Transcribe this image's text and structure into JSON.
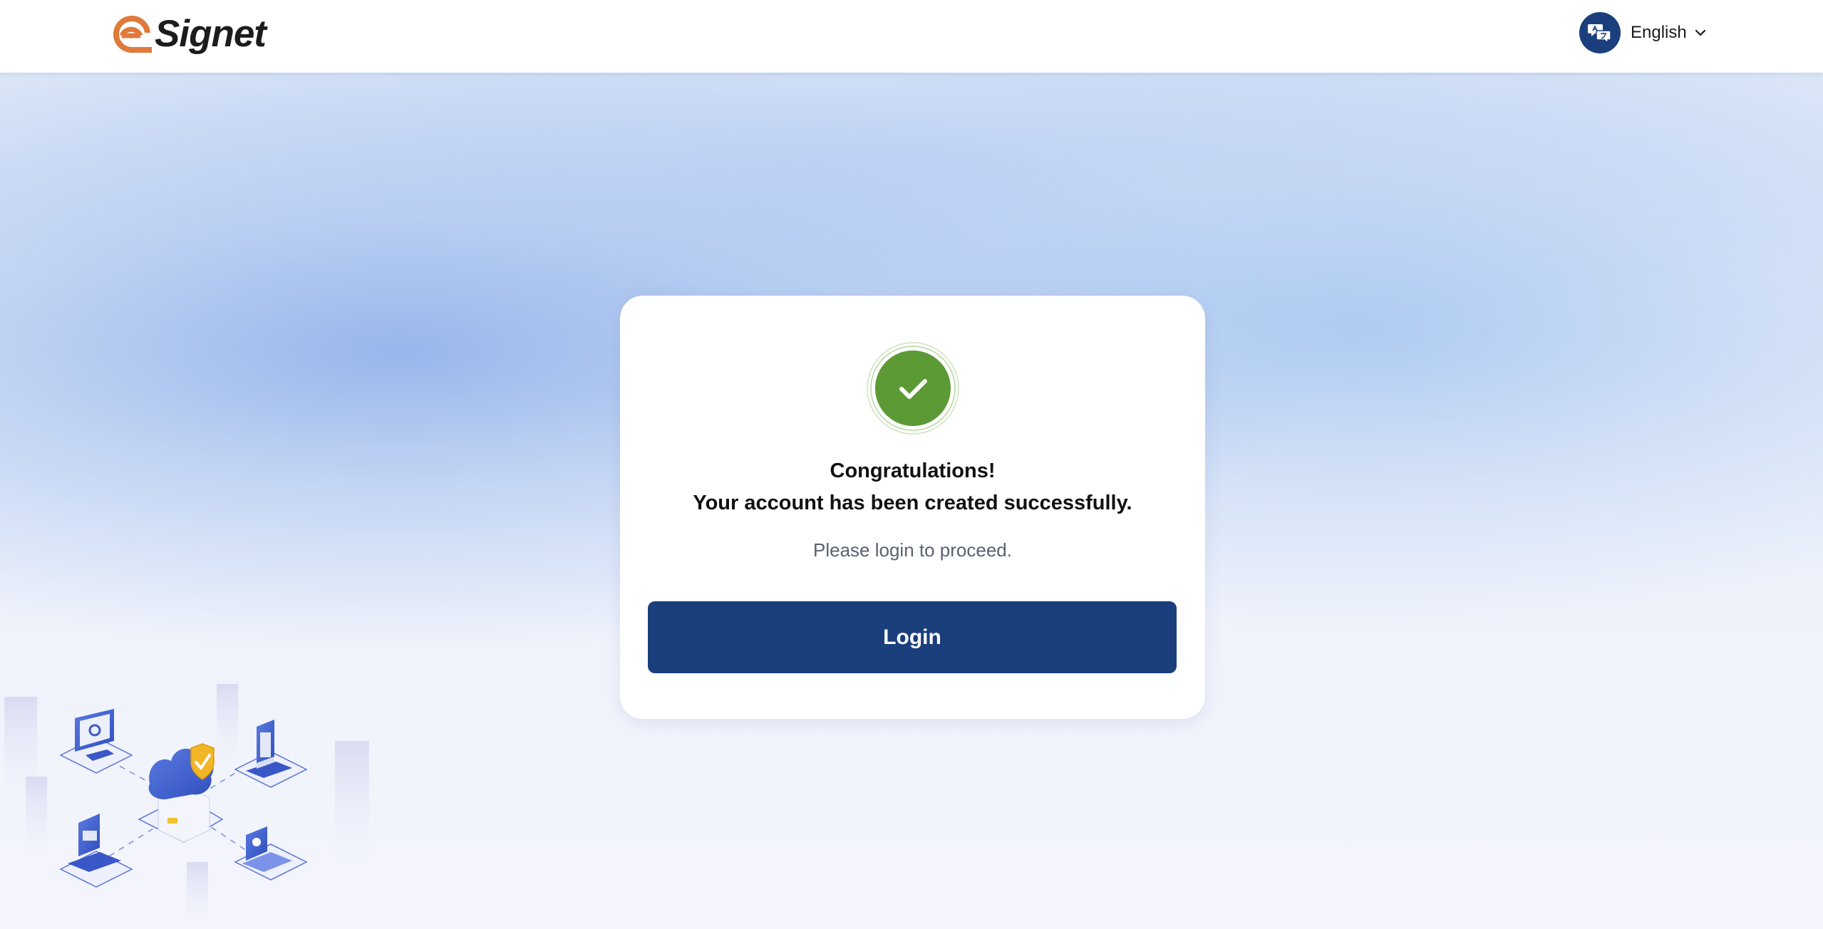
{
  "header": {
    "brand": "Signet",
    "language": {
      "label": "English"
    }
  },
  "card": {
    "title_line1": "Congratulations!",
    "title_line2": "Your account has been created successfully.",
    "subtitle": "Please login to proceed.",
    "login_label": "Login"
  },
  "icons": {
    "brand_logo": "e-logo-mark",
    "language": "translate-icon",
    "dropdown": "chevron-down-icon",
    "success": "check-icon"
  },
  "colors": {
    "primary": "#1a3f7c",
    "success": "#5c9a35",
    "brand_orange": "#e07a3b"
  }
}
